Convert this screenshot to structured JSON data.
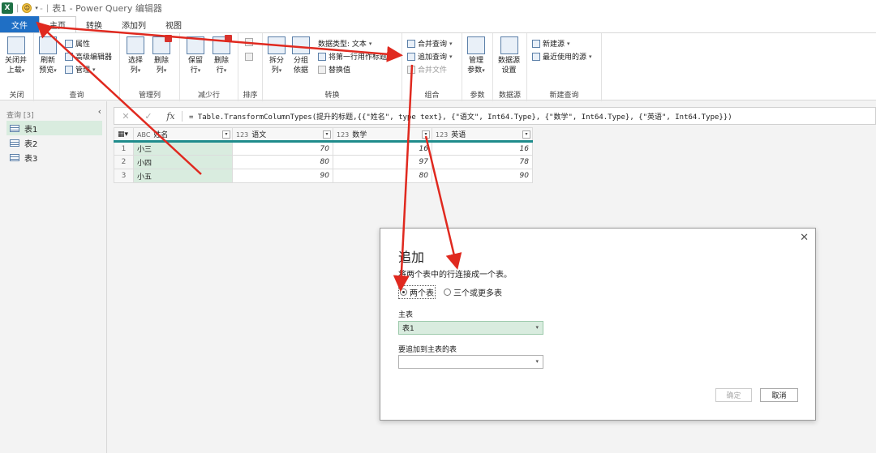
{
  "window": {
    "app_icon_text": "X",
    "title": "表1 - Power Query 编辑器"
  },
  "menu": {
    "tabs": [
      "文件",
      "主页",
      "转换",
      "添加列",
      "视图"
    ]
  },
  "ribbon": {
    "close": {
      "btn1": "关闭并",
      "btn1b": "上载",
      "group": "关闭"
    },
    "query": {
      "refresh": "刷新",
      "refresh2": "预览",
      "properties": "属性",
      "advanced": "高级编辑器",
      "manage": "管理",
      "group": "查询"
    },
    "columns": {
      "choose": "选择",
      "choose2": "列",
      "remove": "删除",
      "remove2": "列",
      "group": "管理列"
    },
    "rows": {
      "keep": "保留",
      "keep2": "行",
      "remove": "删除",
      "remove2": "行",
      "group": "减少行"
    },
    "sort": {
      "group": "排序"
    },
    "transform": {
      "split": "拆分",
      "split2": "列",
      "group_by": "分组",
      "group_by2": "依据",
      "datatype": "数据类型: 文本",
      "first_row_header": "将第一行用作标题",
      "replace": "替换值",
      "group": "转换"
    },
    "combine": {
      "merge": "合并查询",
      "append": "追加查询",
      "merge_files": "合并文件",
      "group": "组合"
    },
    "params": {
      "manage": "管理",
      "manage2": "参数",
      "group": "参数"
    },
    "datasource": {
      "settings": "数据源",
      "settings2": "设置",
      "group": "数据源"
    },
    "newquery": {
      "new_source": "新建源",
      "recent": "最近使用的源",
      "group": "新建查询"
    }
  },
  "queries_pane": {
    "header": "查询 [3]",
    "items": [
      {
        "label": "表1",
        "selected": true
      },
      {
        "label": "表2",
        "selected": false
      },
      {
        "label": "表3",
        "selected": false
      }
    ]
  },
  "formula": {
    "cancel": "✕",
    "confirm": "✓",
    "fx": "fx",
    "text": "= Table.TransformColumnTypes(提升的标题,{{\"姓名\", type text}, {\"语文\", Int64.Type}, {\"数学\", Int64.Type}, {\"英语\", Int64.Type}})"
  },
  "table": {
    "columns": [
      {
        "type": "ABC",
        "name": "姓名"
      },
      {
        "type": "123",
        "name": "语文"
      },
      {
        "type": "123",
        "name": "数学"
      },
      {
        "type": "123",
        "name": "英语"
      }
    ],
    "rows": [
      {
        "n": "1",
        "name": "小三",
        "c": "70",
        "m": "16",
        "e": "16"
      },
      {
        "n": "2",
        "name": "小四",
        "c": "80",
        "m": "97",
        "e": "78"
      },
      {
        "n": "3",
        "name": "小五",
        "c": "90",
        "m": "80",
        "e": "90"
      }
    ]
  },
  "dialog": {
    "title": "追加",
    "description": "将两个表中的行连接成一个表。",
    "option_two": "两个表",
    "option_three": "三个或更多表",
    "primary_label": "主表",
    "primary_value": "表1",
    "append_label": "要追加到主表的表",
    "append_value": "",
    "ok": "确定",
    "cancel": "取消"
  },
  "colors": {
    "file_tab": "#1f6fc5",
    "selection": "#d9ecdf",
    "header_accent": "#1f8c8c",
    "arrow": "#e0291f"
  }
}
